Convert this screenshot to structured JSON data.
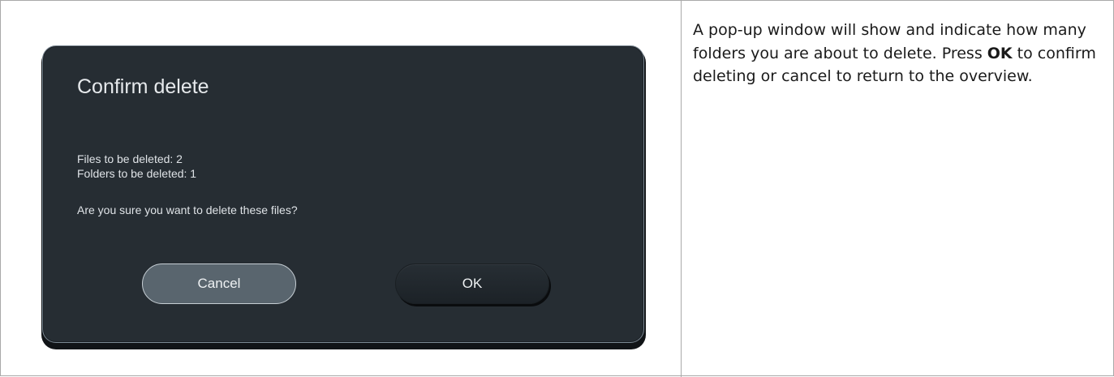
{
  "dialog": {
    "title": "Confirm delete",
    "files_line": "Files to be deleted: 2",
    "folders_line": "Folders to be deleted: 1",
    "question": "Are you sure you want to delete these files?",
    "cancel_label": "Cancel",
    "ok_label": "OK"
  },
  "description": {
    "part1": "A pop-up window will show and indicate how many folders you are about to delete. Press ",
    "bold": "OK",
    "part2": " to confirm deleting or cancel to return to the overview."
  },
  "colors": {
    "dialog_background": "#262d33",
    "cancel_button": "#59656e",
    "ok_button": "#1f252a"
  }
}
